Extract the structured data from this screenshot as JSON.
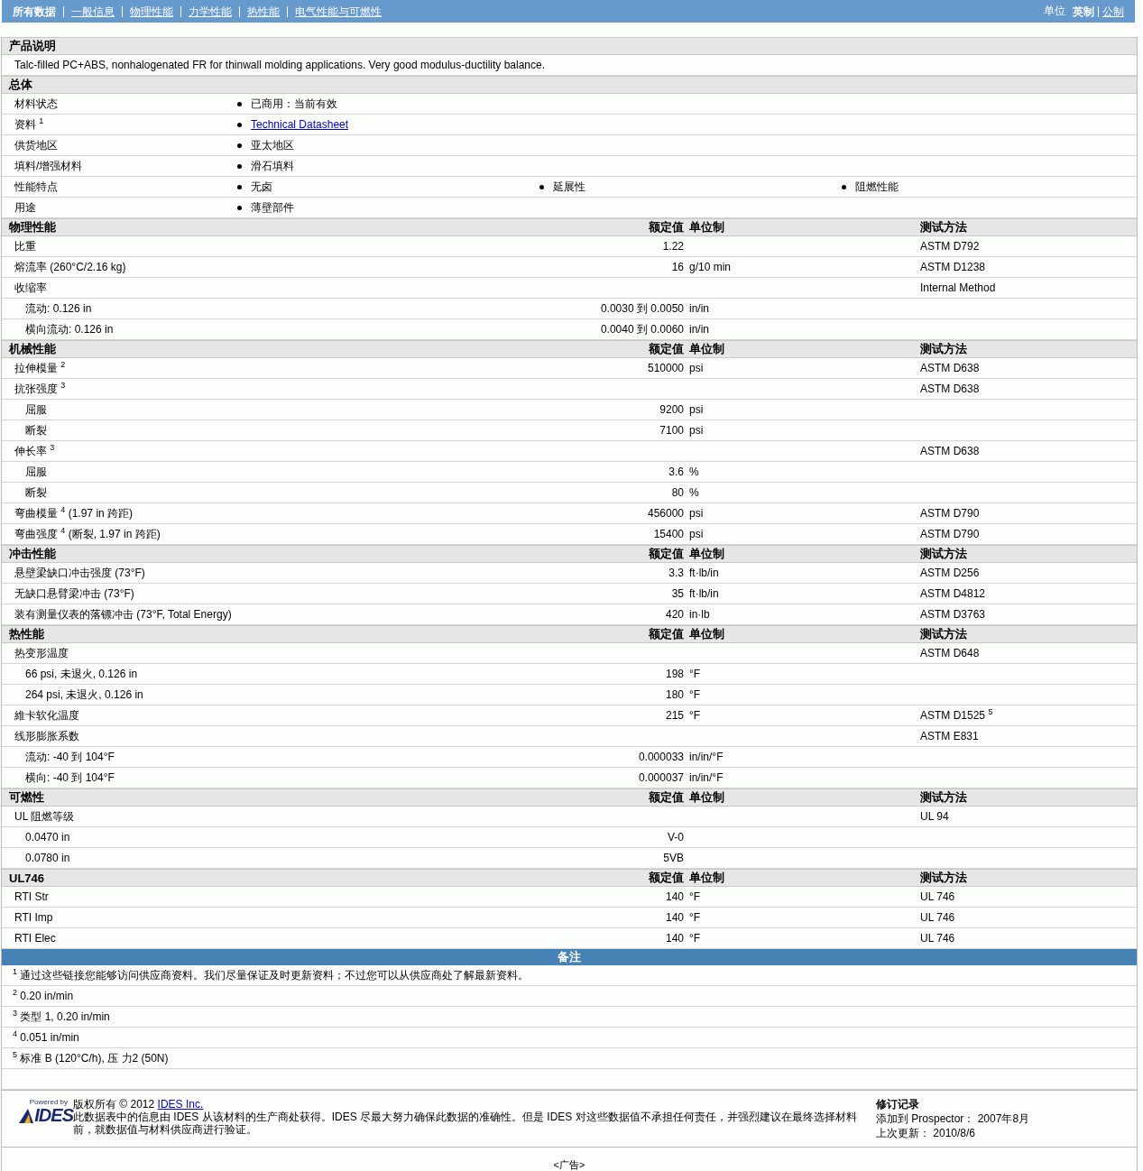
{
  "topbar": {
    "tabs": [
      {
        "label": "所有数据",
        "selected": true
      },
      {
        "label": "一般信息",
        "selected": false
      },
      {
        "label": "物理性能",
        "selected": false
      },
      {
        "label": "力学性能",
        "selected": false
      },
      {
        "label": "热性能",
        "selected": false
      },
      {
        "label": "电气性能与可燃性",
        "selected": false
      }
    ],
    "units_label": "单位",
    "units": [
      {
        "label": "英制",
        "selected": true
      },
      {
        "label": "公制",
        "selected": false
      }
    ]
  },
  "description": {
    "title": "产品说明",
    "text": "Talc-filled PC+ABS, nonhalogenated FR for thinwall molding applications. Very good modulus-ductility balance."
  },
  "general": {
    "title": "总体",
    "rows": [
      {
        "label": "材料状态",
        "values": [
          {
            "text": "已商用：当前有效",
            "kind": "text"
          }
        ]
      },
      {
        "label": "资料 $^{1}$",
        "values": [
          {
            "text": "Technical Datasheet",
            "kind": "link"
          }
        ]
      },
      {
        "label": "供货地区",
        "values": [
          {
            "text": "亚太地区",
            "kind": "text"
          }
        ]
      },
      {
        "label": "填料/增强材料",
        "values": [
          {
            "text": "滑石填料",
            "kind": "text"
          }
        ]
      },
      {
        "label": "性能特点",
        "values": [
          {
            "text": "无卤",
            "kind": "text"
          },
          {
            "text": "延展性",
            "kind": "text"
          },
          {
            "text": "阻燃性能",
            "kind": "text"
          }
        ]
      },
      {
        "label": "用途",
        "values": [
          {
            "text": "薄壁部件",
            "kind": "text"
          }
        ]
      }
    ]
  },
  "sections": [
    {
      "title": "物理性能",
      "columns": [
        "额定值",
        "单位制",
        "测试方法"
      ],
      "rows": [
        {
          "label": "比重",
          "value": "1.22",
          "method": "ASTM D792"
        },
        {
          "label": "熔流率 (260°C/2.16 kg)",
          "value": "16",
          "unit": "g/10 min",
          "method": "ASTM D1238"
        },
        {
          "label": "收缩率",
          "method": "Internal Method",
          "children": [
            {
              "label": "流动: 0.126 in",
              "value": "0.0030 到 0.0050",
              "unit": "in/in"
            },
            {
              "label": "横向流动: 0.126 in",
              "value": "0.0040 到 0.0060",
              "unit": "in/in"
            }
          ]
        }
      ]
    },
    {
      "title": "机械性能",
      "columns": [
        "额定值",
        "单位制",
        "测试方法"
      ],
      "rows": [
        {
          "label": "拉伸模量 $^{2}$",
          "value": "510000",
          "unit": "psi",
          "method": "ASTM D638"
        },
        {
          "label": "抗张强度 $^{3}$",
          "method": "ASTM D638",
          "children": [
            {
              "label": "屈服",
              "value": "9200",
              "unit": "psi"
            },
            {
              "label": "断裂",
              "value": "7100",
              "unit": "psi"
            }
          ]
        },
        {
          "label": "伸长率 $^{3}$",
          "method": "ASTM D638",
          "children": [
            {
              "label": "屈服",
              "value": "3.6",
              "unit": "%"
            },
            {
              "label": "断裂",
              "value": "80",
              "unit": "%"
            }
          ]
        },
        {
          "label": "弯曲模量 $^{4}$ (1.97 in 跨距)",
          "value": "456000",
          "unit": "psi",
          "method": "ASTM D790"
        },
        {
          "label": "弯曲强度 $^{4}$ (断裂, 1.97 in 跨距)",
          "value": "15400",
          "unit": "psi",
          "method": "ASTM D790"
        }
      ]
    },
    {
      "title": "冲击性能",
      "columns": [
        "额定值",
        "单位制",
        "测试方法"
      ],
      "rows": [
        {
          "label": "悬壁梁缺口冲击强度 (73°F)",
          "value": "3.3",
          "unit": "ft·lb/in",
          "method": "ASTM D256"
        },
        {
          "label": "无缺口悬臂梁冲击 (73°F)",
          "value": "35",
          "unit": "ft·lb/in",
          "method": "ASTM D4812"
        },
        {
          "label": "装有测量仪表的落镖冲击 (73°F, Total Energy)",
          "value": "420",
          "unit": "in·lb",
          "method": "ASTM D3763"
        }
      ]
    },
    {
      "title": "热性能",
      "columns": [
        "额定值",
        "单位制",
        "测试方法"
      ],
      "rows": [
        {
          "label": "热变形温度",
          "method": "ASTM D648",
          "children": [
            {
              "label": "66 psi, 未退火, 0.126 in",
              "value": "198",
              "unit": "°F"
            },
            {
              "label": "264 psi, 未退火, 0.126 in",
              "value": "180",
              "unit": "°F"
            }
          ]
        },
        {
          "label": "維卡软化温度",
          "value": "215",
          "unit": "°F",
          "method": "ASTM D1525 $^{5}$"
        },
        {
          "label": "线形膨胀系数",
          "method": "ASTM E831",
          "children": [
            {
              "label": "流动: -40 到 104°F",
              "value": "0.000033",
              "unit": "in/in/°F"
            },
            {
              "label": "横向: -40 到 104°F",
              "value": "0.000037",
              "unit": "in/in/°F"
            }
          ]
        }
      ]
    },
    {
      "title": "可燃性",
      "columns": [
        "额定值",
        "单位制",
        "测试方法"
      ],
      "rows": [
        {
          "label": "UL 阻燃等级",
          "method": "UL 94",
          "children": [
            {
              "label": "0.0470 in",
              "value": "V-0"
            },
            {
              "label": "0.0780 in",
              "value": "5VB"
            }
          ]
        }
      ]
    },
    {
      "title": "UL746",
      "columns": [
        "额定值",
        "单位制",
        "测试方法"
      ],
      "rows": [
        {
          "label": "RTI Str",
          "value": "140",
          "unit": "°F",
          "method": "UL 746"
        },
        {
          "label": "RTI Imp",
          "value": "140",
          "unit": "°F",
          "method": "UL 746"
        },
        {
          "label": "RTI Elec",
          "value": "140",
          "unit": "°F",
          "method": "UL 746"
        }
      ]
    }
  ],
  "notes": {
    "title": "备注",
    "items": [
      "$^{1}$ 通过这些链接您能够访问供应商资料。我们尽量保证及时更新资料；不过您可以从供应商处了解最新资料。",
      "$^{2}$ 0.20 in/min",
      "$^{3}$ 类型 1, 0.20 in/min",
      "$^{4}$ 0.051 in/min",
      "$^{5}$ 标准 B (120°C/h), 压 力2 (50N)"
    ]
  },
  "footer": {
    "logo_tagline": "Powered by",
    "logo_name": "IDES",
    "copyright": "版权所有 © 2012",
    "copyright_link": "IDES Inc.",
    "disclaimer": "此数据表中的信息由 IDES 从该材料的生产商处获得。IDES 尽最大努力确保此数据的准确性。但是 IDES 对这些数据值不承担任何责任，并强烈建议在最终选择材料前，就数据值与材料供应商进行验证。",
    "revision_title": "修订记录",
    "revision_lines": [
      "添加到 Prospector： 2007年8月",
      "上次更新： 2010/8/6"
    ],
    "ad": "<广告>"
  }
}
